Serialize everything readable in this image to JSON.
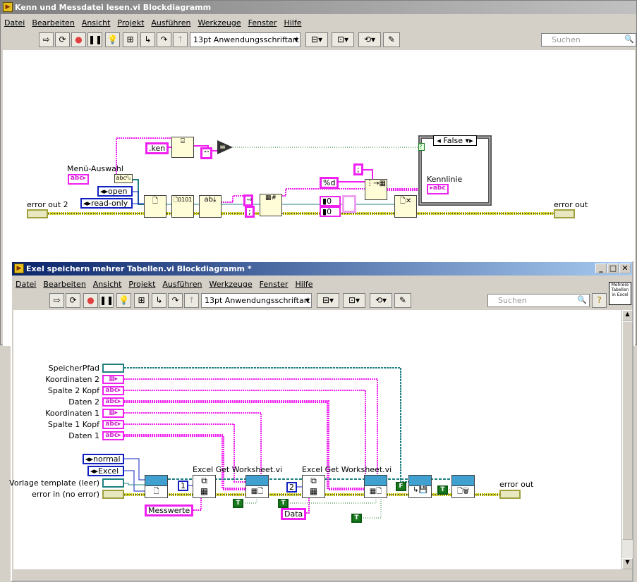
{
  "window1": {
    "title": "Kenn und Messdatei lesen.vi Blockdiagramm",
    "menu": [
      "Datei",
      "Bearbeiten",
      "Ansicht",
      "Projekt",
      "Ausführen",
      "Werkzeuge",
      "Fenster",
      "Hilfe"
    ],
    "font_select": "13pt Anwendungsschriftart",
    "search_placeholder": "Suchen",
    "diagram": {
      "menu_label": "Menü-Auswahl",
      "ken_const": ".ken",
      "empty_const": "\"\"",
      "eq_symbol": "=",
      "open_enum": "open",
      "readonly_enum": "read-only",
      "error_out2_label": "error out 2",
      "semicolon1": ";",
      "semicolon2": ";",
      "format_const": "%d",
      "num0a": "0",
      "num0b": "0",
      "case_selector": "False",
      "kennlinie_label": "Kennlinie",
      "error_out_label": "error out",
      "case_terminal": "?"
    }
  },
  "window2": {
    "title": "Exel speichern mehrer Tabellen.vi Blockdiagramm *",
    "menu": [
      "Datei",
      "Bearbeiten",
      "Ansicht",
      "Projekt",
      "Ausführen",
      "Werkzeuge",
      "Fenster",
      "Hilfe"
    ],
    "font_select": "13pt Anwendungsschriftart",
    "search_placeholder": "Suchen",
    "vi_icon_text": "Mehrere Tabellen in Excel",
    "diagram": {
      "controls": [
        "SpeicherPfad",
        "Koordinaten 2",
        "Spalte 2 Kopf",
        "Daten 2",
        "Koordinaten 1",
        "Spalte 1 Kopf",
        "Daten 1"
      ],
      "normal_enum": "normal",
      "excel_enum": "Excel",
      "vorlage_label": "Vorlage template (leer)",
      "error_in_label": "error in (no error)",
      "get_ws_label1": "Excel Get Worksheet.vi",
      "get_ws_label2": "Excel Get Worksheet.vi",
      "const1": "1",
      "const2": "2",
      "messwerte": "Messwerte",
      "data": "Data",
      "true_const": "T",
      "false_const": "F",
      "error_out_label": "error out"
    }
  },
  "colors": {
    "string_wire": "#f020f0",
    "error_wire": "#c8c800",
    "path_wire": "#208080",
    "enum": "#1020c0",
    "bool": "#1a7a20",
    "title_active": "#0a246a"
  }
}
